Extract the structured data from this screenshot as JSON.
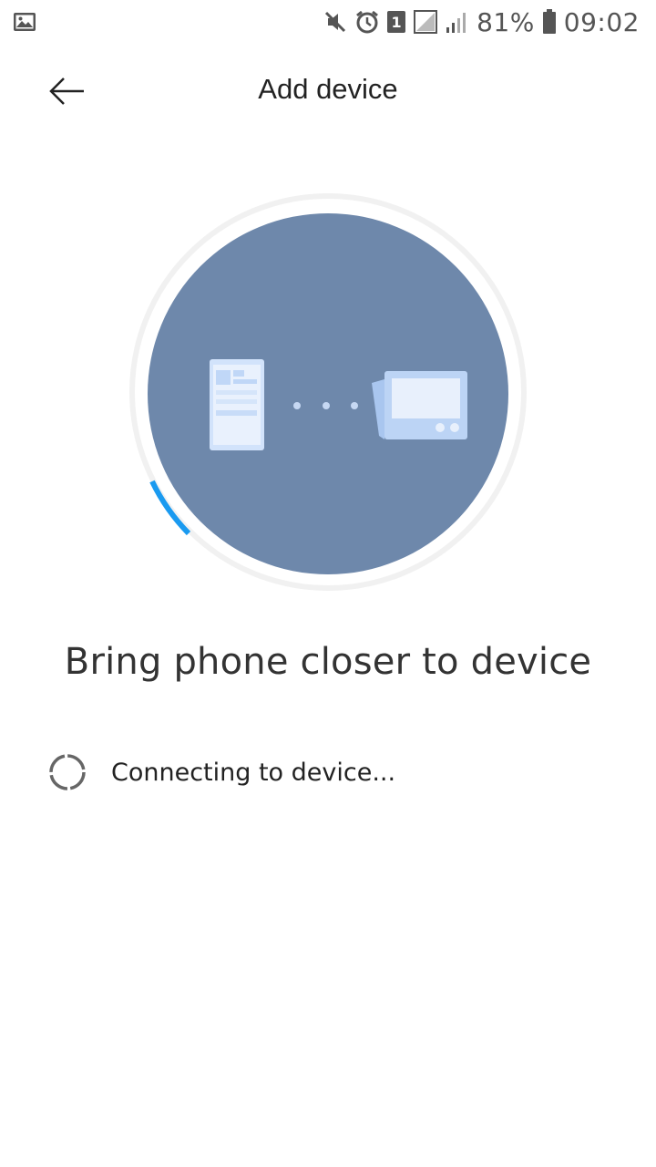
{
  "status_bar": {
    "battery": "81%",
    "time": "09:02",
    "sim_slot": "1",
    "icons": [
      "gallery-icon",
      "mute-icon",
      "alarm-icon",
      "sim-icon",
      "signal-empty-icon",
      "signal-weak-icon",
      "battery-icon"
    ]
  },
  "header": {
    "title": "Add device",
    "back_icon": "arrow-left-icon"
  },
  "illustration": {
    "icons": [
      "phone-icon",
      "dots-icon",
      "device-screen-icon"
    ],
    "circle_color": "#6e88ab",
    "progress_color": "#1a9af0",
    "progress": 0.1
  },
  "instruction": "Bring phone closer to device",
  "status": {
    "text": "Connecting to device...",
    "icon": "loading-spinner-icon"
  }
}
